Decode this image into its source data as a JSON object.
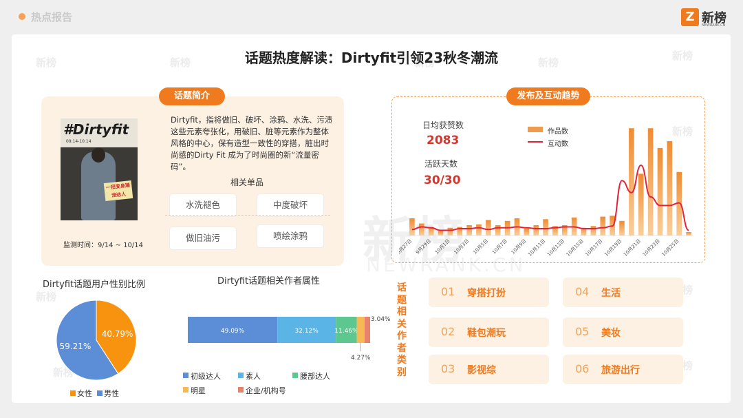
{
  "header": {
    "section_title": "热点报告",
    "brand_name": "新榜",
    "brand_sub": "NEWRANK.CN"
  },
  "watermark": {
    "text": "新榜",
    "large_sub": "NEWRANK.CN"
  },
  "title": "话题热度解读：Dirtyfit引领23秋冬潮流",
  "intro": {
    "pill": "话题简介",
    "cover_title": "#Dirtyfit",
    "cover_date": "09.14-10.14",
    "cover_sticker": "一招变身潮流达人",
    "description": "Dirtyfit，指将做旧、破坏、涂鸦、水洗、污渍这些元素夸张化，用破旧、脏等元素作为整体风格的中心，保有造型一致性的穿搭，脏出时尚感的Dirty Fit 成为了时尚圈的新“流量密码”。",
    "related_title": "相关单品",
    "tags": [
      "水洗褪色",
      "中度破坏",
      "做旧油污",
      "喷绘涂鸦"
    ],
    "monitor": "监测时间：9/14 ~ 10/14"
  },
  "trend": {
    "pill": "发布及互动趋势",
    "likes_label": "日均获赞数",
    "likes_value": "2083",
    "days_label": "活跃天数",
    "days_value": "30/30",
    "legend_works": "作品数",
    "legend_interact": "互动数",
    "colors": {
      "bars": "#f0a35d",
      "line": "#e2243a"
    }
  },
  "gender": {
    "title": "Dirtyfit话题用户性别比例",
    "female_label": "40.79%",
    "male_label": "59.21%",
    "legend_female": "女性",
    "legend_male": "男性",
    "colors": {
      "female": "#f7930e",
      "male": "#5b8ed6"
    }
  },
  "creators": {
    "title": "Dirtyfit话题相关作者属性",
    "segment_labels": [
      "49.09%",
      "32.12%",
      "11.46%",
      "4.27%",
      "3.04%"
    ],
    "legend": [
      "初级达人",
      "素人",
      "腰部达人",
      "明星",
      "企业/机构号"
    ],
    "colors": [
      "#5b8ed6",
      "#5ab4e5",
      "#5cc78e",
      "#f7b955",
      "#e8826a"
    ]
  },
  "categories": {
    "vertical_label": "话题相关作者类别",
    "items": [
      {
        "num": "01",
        "name": "穿搭打扮"
      },
      {
        "num": "02",
        "name": "鞋包潮玩"
      },
      {
        "num": "03",
        "name": "影视综"
      },
      {
        "num": "04",
        "name": "生活"
      },
      {
        "num": "05",
        "name": "美妆"
      },
      {
        "num": "06",
        "name": "旅游出行"
      }
    ]
  },
  "chart_data": [
    {
      "type": "bar",
      "x": [
        "9月27日",
        "9月28日",
        "9月29日",
        "9月30日",
        "10月1日",
        "10月2日",
        "10月3日",
        "10月4日",
        "10月5日",
        "10月6日",
        "10月7日",
        "10月8日",
        "10月9日",
        "10月10日",
        "10月11日",
        "10月12日",
        "10月13日",
        "10月14日",
        "10月15日",
        "10月16日",
        "10月17日",
        "10月18日",
        "10月19日",
        "10月20日",
        "10月21日",
        "10月22日",
        "10月23日",
        "10月24日",
        "10月25日",
        "10月26日"
      ],
      "x_tick_labels": [
        "9月27日",
        "9月29日",
        "10月1日",
        "10月3日",
        "10月5日",
        "10月7日",
        "10月9日",
        "10月11日",
        "10月13日",
        "10月15日",
        "10月17日",
        "10月19日",
        "10月21日",
        "10月23日",
        "10月25日"
      ],
      "series": [
        {
          "name": "作品数",
          "values": [
            20,
            14,
            10,
            5,
            9,
            10,
            12,
            13,
            18,
            12,
            17,
            20,
            8,
            12,
            19,
            11,
            12,
            21,
            9,
            11,
            22,
            23,
            17,
            125,
            72,
            125,
            102,
            110,
            74,
            4
          ]
        },
        {
          "name": "互动数",
          "values": [
            7,
            10,
            9,
            6,
            6,
            8,
            8,
            9,
            7,
            9,
            9,
            10,
            9,
            8,
            8,
            9,
            10,
            10,
            8,
            8,
            9,
            11,
            64,
            50,
            82,
            45,
            35,
            35,
            38,
            6
          ]
        }
      ],
      "legend": [
        "作品数",
        "互动数"
      ]
    },
    {
      "type": "pie",
      "title": "Dirtyfit话题用户性别比例",
      "labels": [
        "女性",
        "男性"
      ],
      "values": [
        40.79,
        59.21
      ]
    },
    {
      "type": "bar",
      "title": "Dirtyfit话题相关作者属性",
      "stacked": true,
      "categories": [
        "初级达人",
        "素人",
        "腰部达人",
        "明星",
        "企业/机构号"
      ],
      "values": [
        49.09,
        32.12,
        11.46,
        4.27,
        3.04
      ]
    }
  ]
}
